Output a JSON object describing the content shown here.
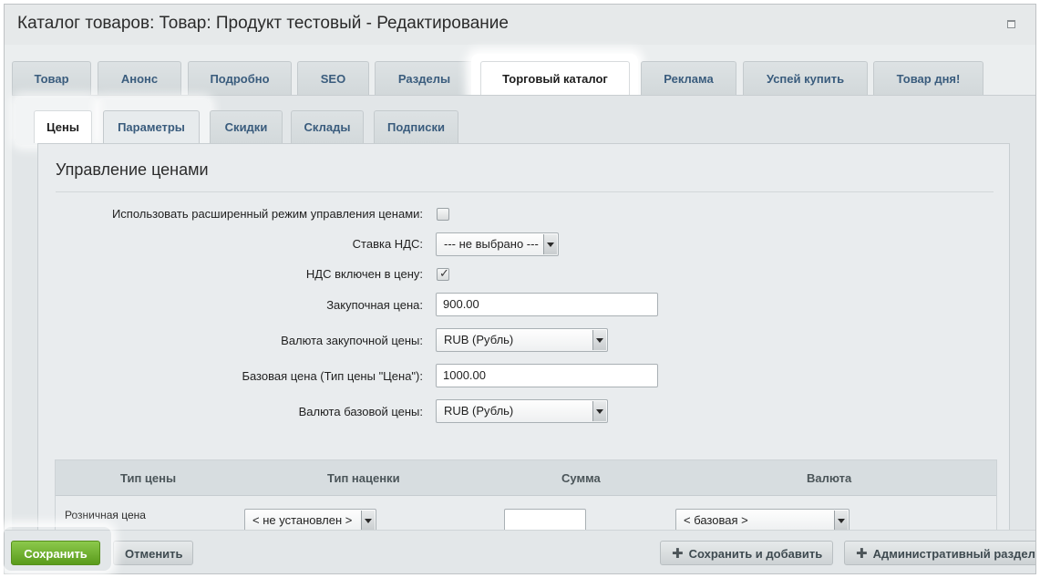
{
  "window": {
    "title": "Каталог товаров: Товар: Продукт тестовый - Редактирование"
  },
  "main_tabs": [
    {
      "label": "Товар"
    },
    {
      "label": "Анонс"
    },
    {
      "label": "Подробно"
    },
    {
      "label": "SEO"
    },
    {
      "label": "Разделы"
    },
    {
      "label": "Торговый каталог",
      "active": true
    },
    {
      "label": "Реклама"
    },
    {
      "label": "Успей купить"
    },
    {
      "label": "Товар дня!"
    }
  ],
  "sub_tabs": [
    {
      "label": "Цены",
      "active": true
    },
    {
      "label": "Параметры"
    },
    {
      "label": "Скидки"
    },
    {
      "label": "Склады"
    },
    {
      "label": "Подписки"
    }
  ],
  "section": {
    "title": "Управление ценами"
  },
  "form": {
    "advanced_mode_label": "Использовать расширенный режим управления ценами:",
    "advanced_mode_checked": false,
    "vat_rate_label": "Ставка НДС:",
    "vat_rate_value": "--- не выбрано ---",
    "vat_included_label": "НДС включен в цену:",
    "vat_included_checked": true,
    "purchase_price_label": "Закупочная цена:",
    "purchase_price_value": "900.00",
    "purchase_currency_label": "Валюта закупочной цены:",
    "purchase_currency_value": "RUB (Рубль)",
    "base_price_label": "Базовая цена (Тип цены \"Цена\"):",
    "base_price_value": "1000.00",
    "base_currency_label": "Валюта базовой цены:",
    "base_currency_value": "RUB (Рубль)"
  },
  "price_table": {
    "headers": [
      "Тип цены",
      "Тип наценки",
      "Сумма",
      "Валюта"
    ],
    "rows": [
      {
        "type": "Розничная цена",
        "markup": "< не установлен >",
        "sum": "",
        "currency": "< базовая >"
      }
    ]
  },
  "footer": {
    "save": "Сохранить",
    "cancel": "Отменить",
    "save_and_add": "Сохранить и добавить",
    "admin_section": "Административный раздел"
  }
}
